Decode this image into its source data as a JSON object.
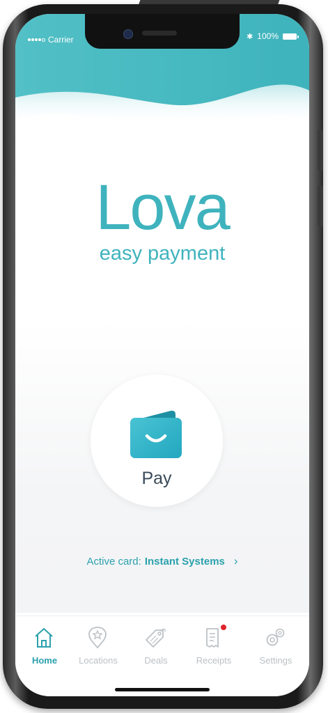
{
  "status_bar": {
    "carrier": "Carrier",
    "battery": "100%"
  },
  "brand": {
    "name": "Lova",
    "tagline": "easy payment",
    "accent_color": "#3fb3bd"
  },
  "pay_button": {
    "label": "Pay",
    "icon": "wallet-icon"
  },
  "active_card": {
    "prefix": "Active card:",
    "name": "Instant Systems",
    "chevron": "›"
  },
  "tabs": [
    {
      "label": "Home",
      "icon": "home-icon",
      "active": true
    },
    {
      "label": "Locations",
      "icon": "location-pin-icon",
      "active": false
    },
    {
      "label": "Deals",
      "icon": "tag-icon",
      "active": false
    },
    {
      "label": "Receipts",
      "icon": "receipt-icon",
      "active": false,
      "badge": true
    },
    {
      "label": "Settings",
      "icon": "gear-icon",
      "active": false
    }
  ],
  "colors": {
    "teal": "#3fb3bd",
    "tab_inactive": "#bcc1c5",
    "badge": "#e0242c"
  }
}
